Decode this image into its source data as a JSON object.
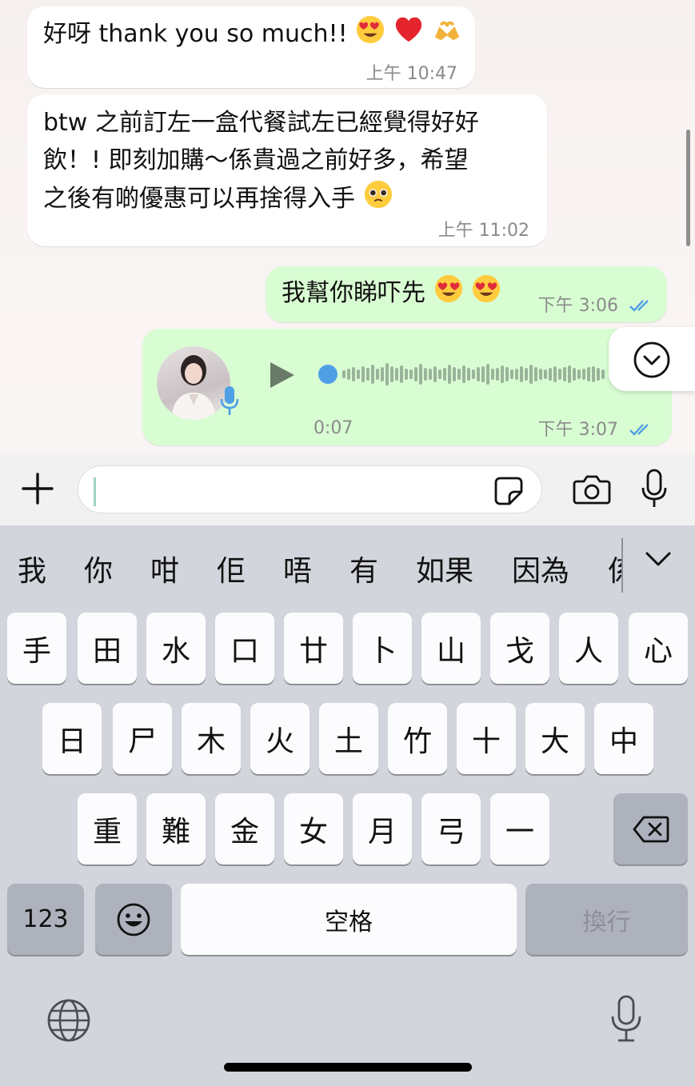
{
  "messages": [
    {
      "id": "m1",
      "direction": "incoming",
      "text": "好呀 thank you so much!!",
      "emoji": [
        "heart-eyes",
        "red-heart",
        "heart-hands"
      ],
      "time": "上午 10:47"
    },
    {
      "id": "m2",
      "direction": "incoming",
      "lines": [
        "btw 之前訂左一盒代餐試左已經覺得好好",
        "飲！! 即刻加購～係貴過之前好多，希望",
        "之後有啲優惠可以再捨得入手"
      ],
      "emoji": [
        "pleading-face"
      ],
      "time": "上午 11:02"
    },
    {
      "id": "m3",
      "direction": "outgoing",
      "text": "我幫你睇吓先",
      "emoji": [
        "heart-eyes",
        "heart-eyes"
      ],
      "time": "下午 3:06",
      "status": "read"
    },
    {
      "id": "m4",
      "direction": "outgoing",
      "type": "voice",
      "duration": "0:07",
      "time": "下午 3:07",
      "status": "read"
    }
  ],
  "input": {
    "value": "",
    "placeholder": ""
  },
  "keyboard": {
    "candidates": [
      "我",
      "你",
      "咁",
      "佢",
      "唔",
      "有",
      "如果",
      "因為",
      "係"
    ],
    "row1": [
      "手",
      "田",
      "水",
      "口",
      "廿",
      "卜",
      "山",
      "戈",
      "人",
      "心"
    ],
    "row2": [
      "日",
      "尸",
      "木",
      "火",
      "土",
      "竹",
      "十",
      "大",
      "中"
    ],
    "row3": [
      "重",
      "難",
      "金",
      "女",
      "月",
      "弓",
      "一"
    ],
    "numbers_label": "123",
    "space_label": "空格",
    "return_label": "換行"
  },
  "colors": {
    "outgoing": "#d9fdd3",
    "incoming": "#ffffff",
    "read_ticks": "#4f9fe6",
    "play": "#6a7a68",
    "waveform": "#9bb39a",
    "keyboard": "#d3d5dd"
  },
  "icons": [
    "plus-icon",
    "sticker-icon",
    "camera-icon",
    "microphone-icon",
    "chevron-down-icon",
    "play-icon",
    "delete-icon",
    "emoji-icon",
    "globe-icon",
    "dictation-icon",
    "read-ticks-icon"
  ]
}
